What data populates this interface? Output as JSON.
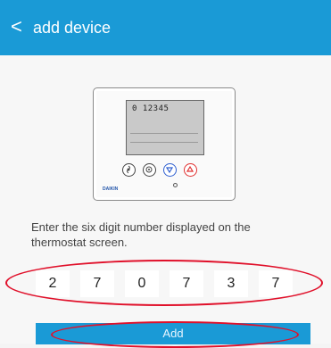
{
  "header": {
    "back_glyph": "<",
    "title": "add device"
  },
  "thermostat": {
    "screen_text": "0 12345",
    "brand": "DAIKIN",
    "buttons": [
      "fan-icon",
      "mode-icon",
      "down-arrow-icon",
      "up-arrow-icon"
    ]
  },
  "instructions": "Enter the six digit number displayed on the thermostat screen.",
  "code": [
    "2",
    "7",
    "0",
    "7",
    "3",
    "7"
  ],
  "add_label": "Add",
  "colors": {
    "header": "#1a9ad6",
    "button": "#1a9ad6",
    "annotation": "#e0102a"
  }
}
